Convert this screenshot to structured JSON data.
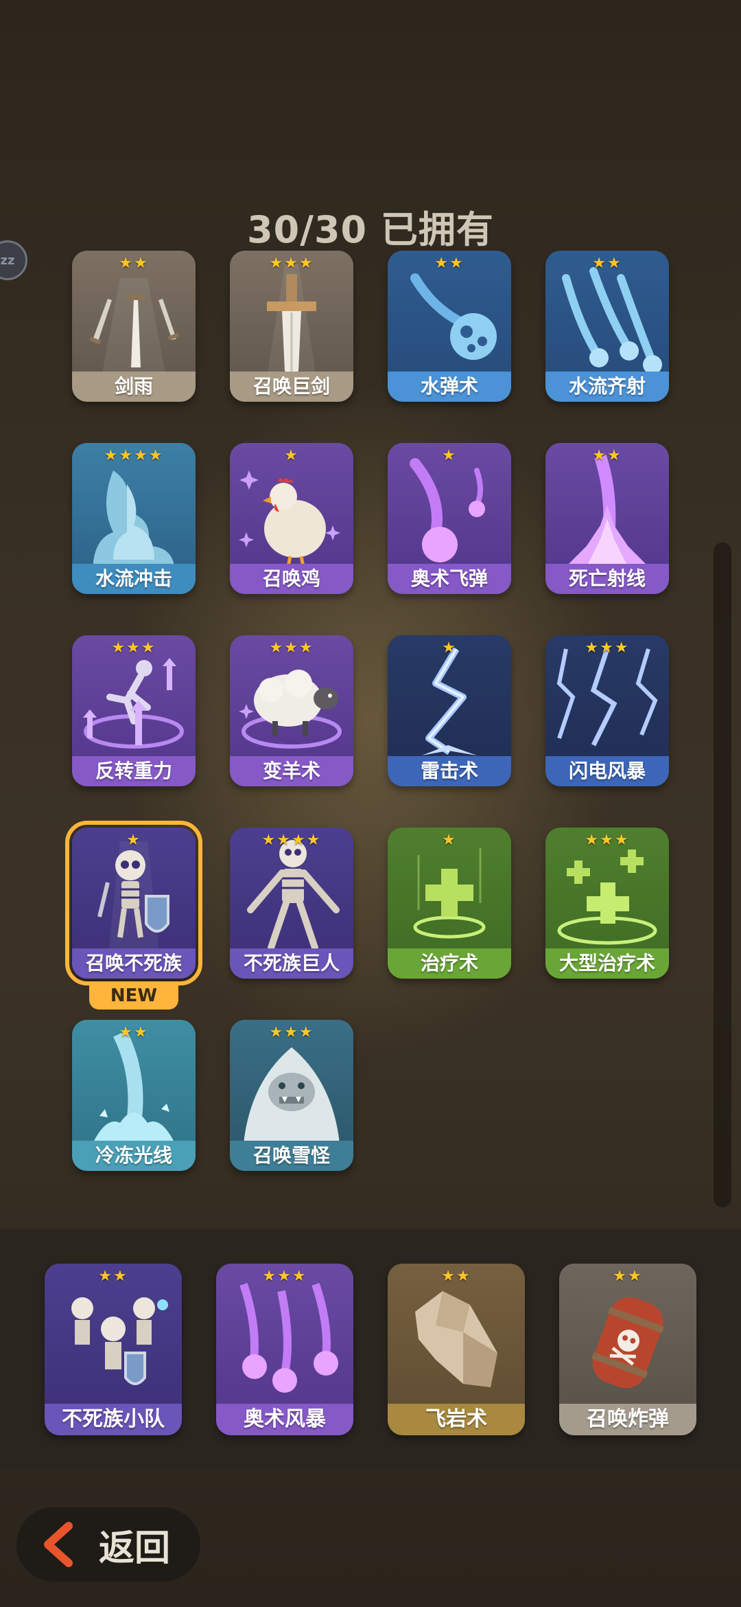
{
  "header": {
    "title": "30/30 已拥有",
    "sleep_icon": "zz"
  },
  "colors": {
    "star": "#ffc629",
    "selected_outline": "#ffb43c",
    "new_badge": "#ffb43c"
  },
  "grid": [
    {
      "name": "剑雨",
      "stars": "★★",
      "theme": "gray",
      "icon": "swords-icon"
    },
    {
      "name": "召唤巨剑",
      "stars": "★★★",
      "theme": "gray",
      "icon": "giant-sword-icon"
    },
    {
      "name": "水弹术",
      "stars": "★★",
      "theme": "blue",
      "icon": "water-ball-icon"
    },
    {
      "name": "水流齐射",
      "stars": "★★",
      "theme": "blue",
      "icon": "water-volley-icon"
    },
    {
      "name": "水流冲击",
      "stars": "★★★★",
      "theme": "teal",
      "icon": "water-burst-icon"
    },
    {
      "name": "召唤鸡",
      "stars": "★",
      "theme": "purple",
      "icon": "chicken-icon"
    },
    {
      "name": "奥术飞弹",
      "stars": "★",
      "theme": "purple",
      "icon": "arcane-missile-icon"
    },
    {
      "name": "死亡射线",
      "stars": "★★",
      "theme": "purple",
      "icon": "death-ray-icon"
    },
    {
      "name": "反转重力",
      "stars": "★★★",
      "theme": "purple",
      "icon": "reverse-gravity-icon"
    },
    {
      "name": "变羊术",
      "stars": "★★★",
      "theme": "purple",
      "icon": "sheep-icon"
    },
    {
      "name": "雷击术",
      "stars": "★",
      "theme": "navy",
      "icon": "lightning-icon"
    },
    {
      "name": "闪电风暴",
      "stars": "★★★",
      "theme": "navy",
      "icon": "lightning-storm-icon"
    },
    {
      "name": "召唤不死族",
      "stars": "★",
      "theme": "violet",
      "icon": "skeleton-shield-icon",
      "selected": true,
      "badge": "NEW"
    },
    {
      "name": "不死族巨人",
      "stars": "★★★★",
      "theme": "violet",
      "icon": "skeleton-giant-icon"
    },
    {
      "name": "治疗术",
      "stars": "★",
      "theme": "green",
      "icon": "heal-cross-icon"
    },
    {
      "name": "大型治疗术",
      "stars": "★★★",
      "theme": "green",
      "icon": "greater-heal-icon"
    },
    {
      "name": "冷冻光线",
      "stars": "★★",
      "theme": "ice",
      "icon": "freeze-ray-icon"
    },
    {
      "name": "召唤雪怪",
      "stars": "★★★",
      "theme": "iceb",
      "icon": "yeti-icon"
    }
  ],
  "equipped": [
    {
      "name": "不死族小队",
      "stars": "★★",
      "theme": "violet",
      "icon": "skeleton-squad-icon"
    },
    {
      "name": "奥术风暴",
      "stars": "★★★",
      "theme": "purple",
      "icon": "arcane-storm-icon"
    },
    {
      "name": "飞岩术",
      "stars": "★★",
      "theme": "brown",
      "icon": "flying-rock-icon"
    },
    {
      "name": "召唤炸弹",
      "stars": "★★",
      "theme": "barrel",
      "icon": "barrel-bomb-icon"
    }
  ],
  "footer": {
    "back_label": "返回"
  }
}
